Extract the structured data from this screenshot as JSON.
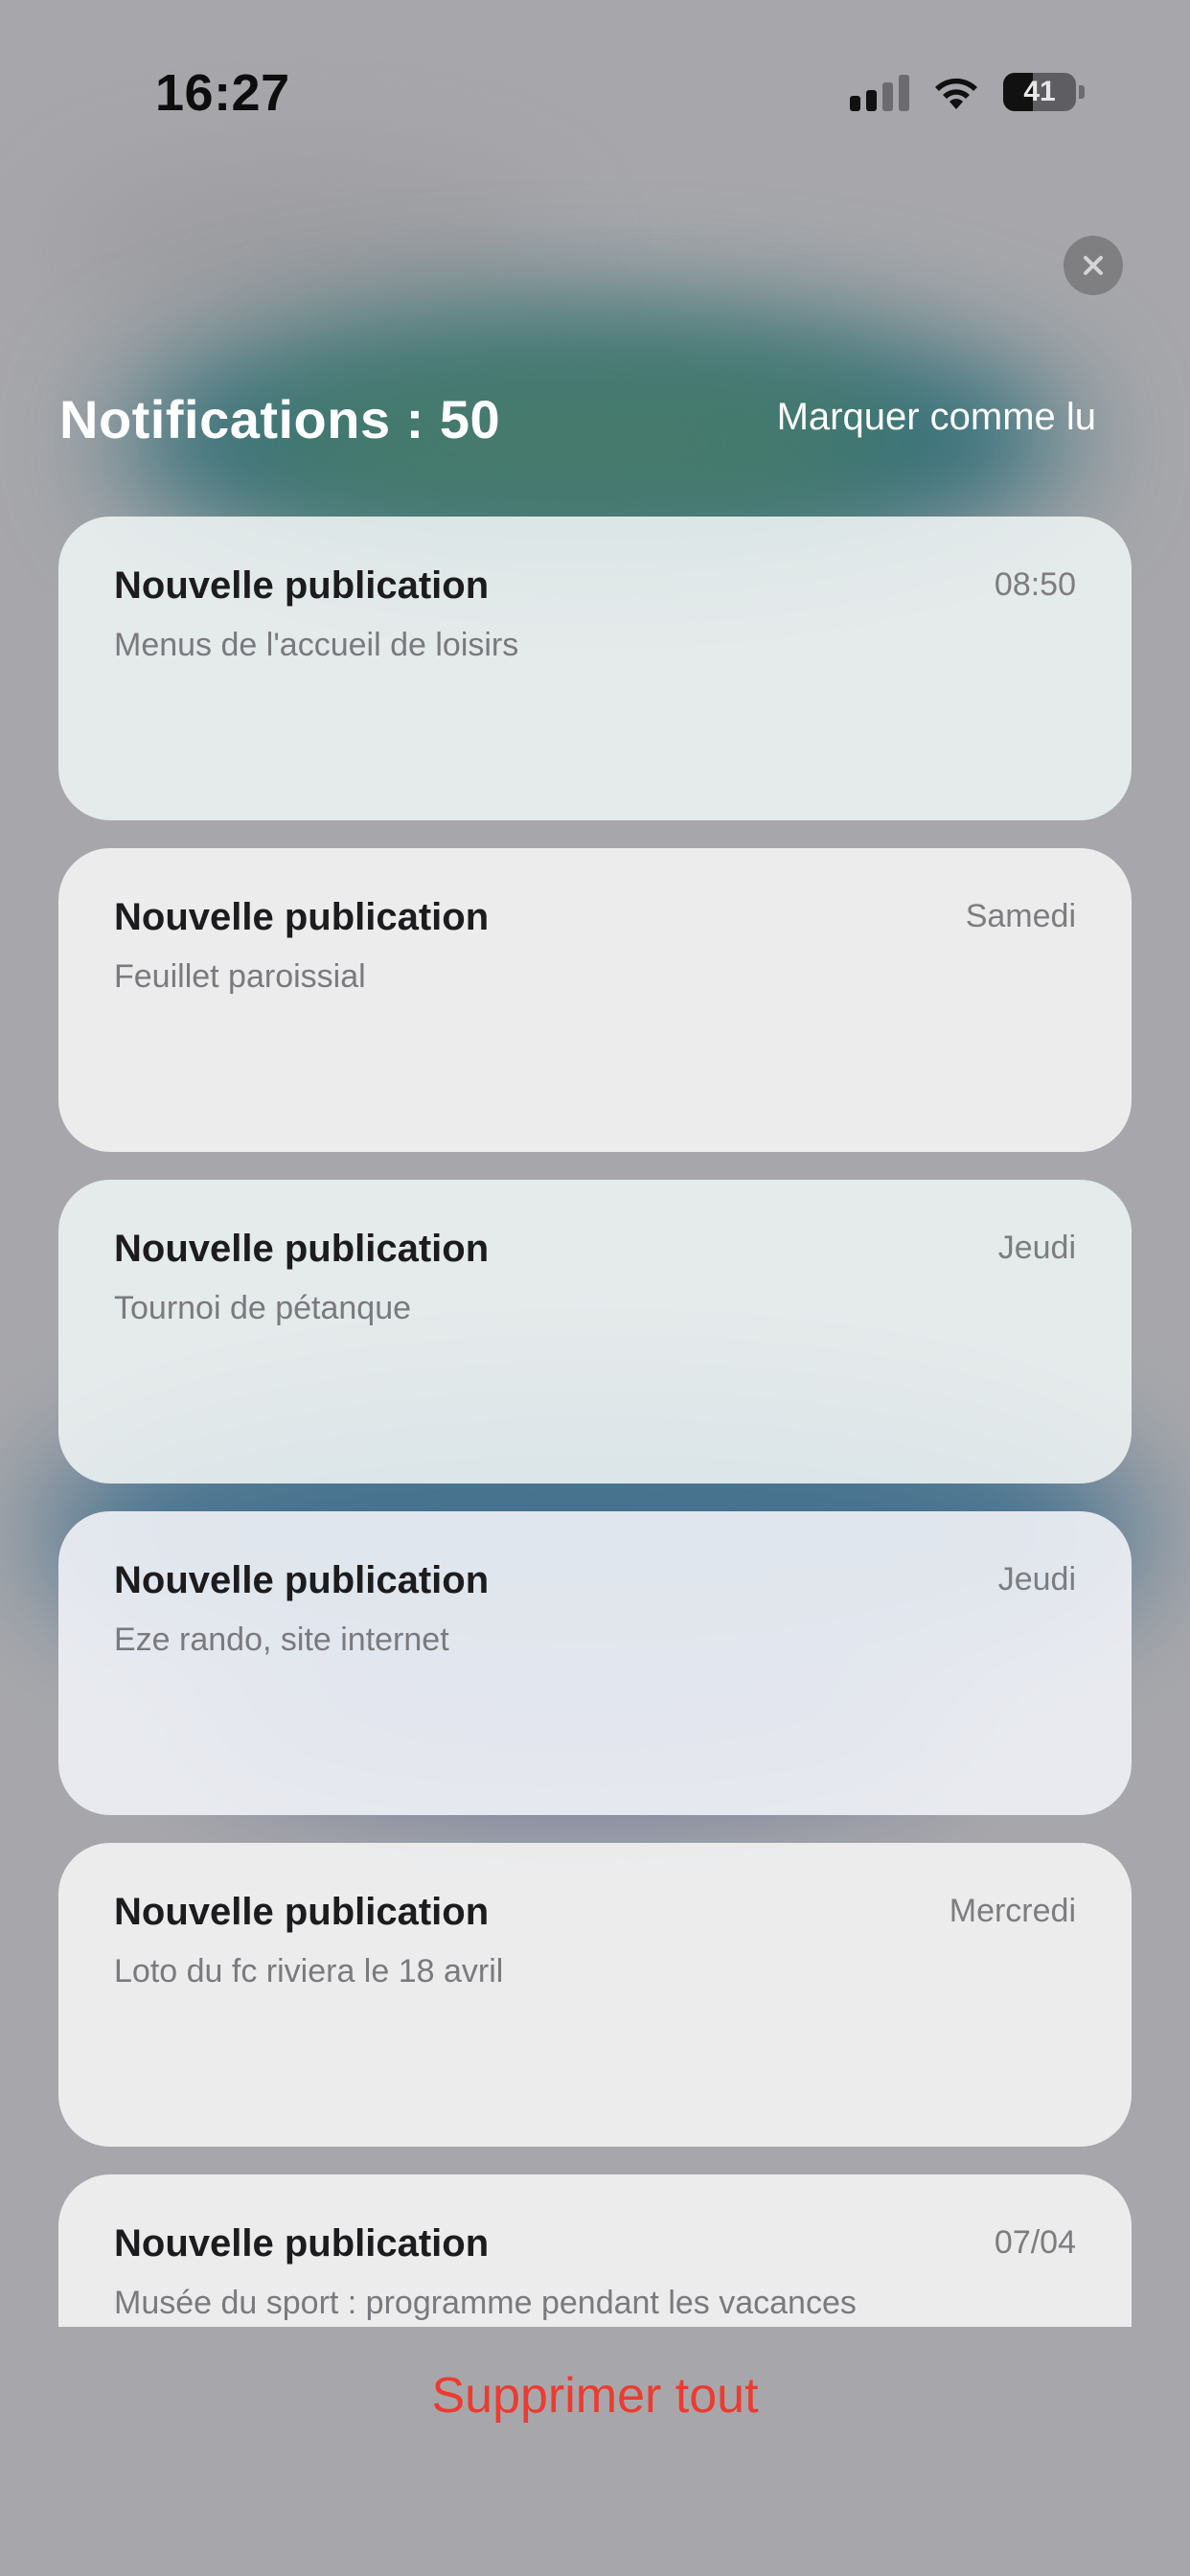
{
  "status_bar": {
    "time": "16:27",
    "battery_level": "41"
  },
  "header": {
    "title": "Notifications : 50",
    "mark_read_label": "Marquer comme lu"
  },
  "notifications": [
    {
      "title": "Nouvelle publication",
      "time": "08:50",
      "body": "Menus de l'accueil de loisirs"
    },
    {
      "title": "Nouvelle publication",
      "time": "Samedi",
      "body": "Feuillet paroissial"
    },
    {
      "title": "Nouvelle publication",
      "time": "Jeudi",
      "body": "Tournoi de pétanque"
    },
    {
      "title": "Nouvelle publication",
      "time": "Jeudi",
      "body": "Eze rando, site internet"
    },
    {
      "title": "Nouvelle publication",
      "time": "Mercredi",
      "body": "Loto du fc riviera le 18 avril"
    },
    {
      "title": "Nouvelle publication",
      "time": "07/04",
      "body": "Musée du sport : programme pendant les vacances"
    }
  ],
  "footer": {
    "delete_all_label": "Supprimer tout"
  },
  "colors": {
    "danger": "#ec3b30",
    "overlay": "#a7a7ab"
  },
  "icons": [
    "cellular-signal-icon",
    "wifi-icon",
    "battery-icon",
    "close-icon"
  ]
}
